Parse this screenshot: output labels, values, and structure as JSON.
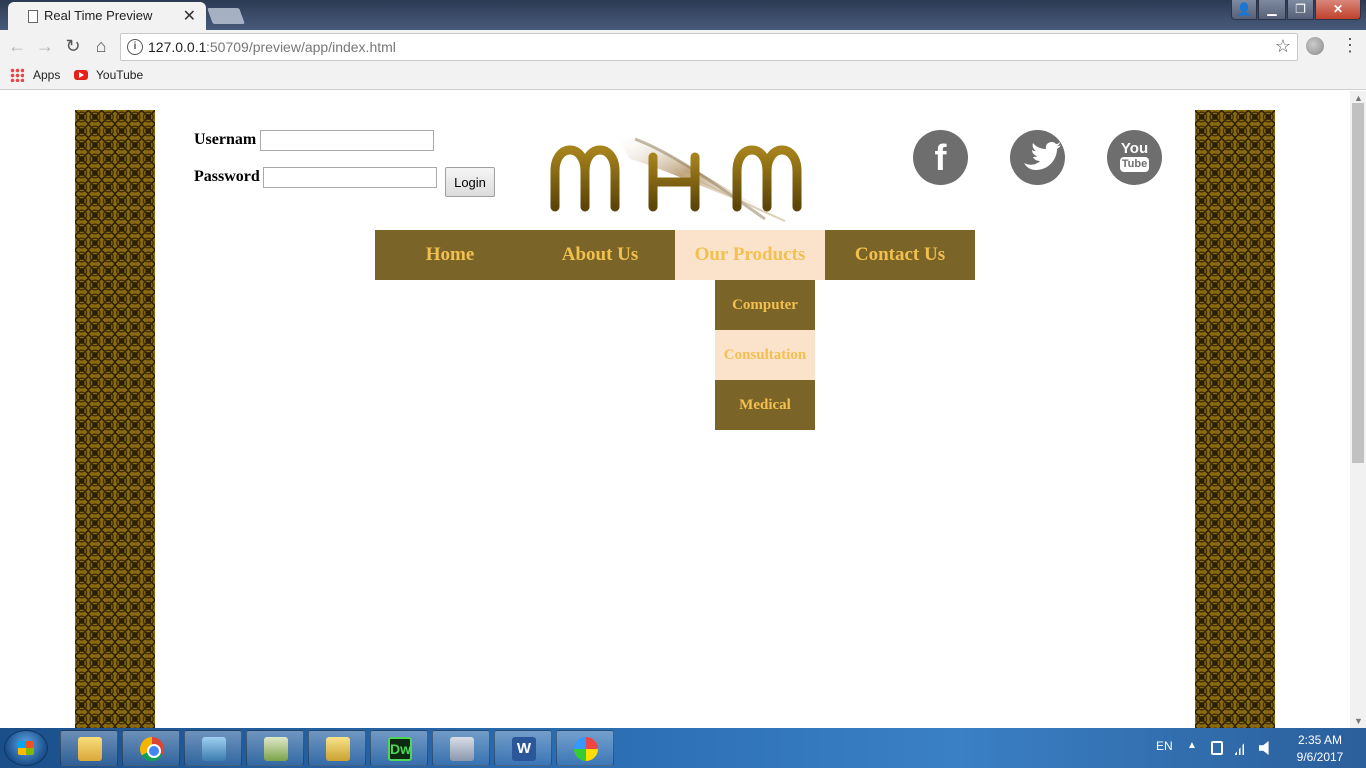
{
  "browser": {
    "tab_title": "Real Time Preview",
    "url_host": "127.0.0.1",
    "url_path": ":50709/preview/app/index.html",
    "bookmarks": [
      {
        "label": "Apps",
        "icon": "apps-grid-icon"
      },
      {
        "label": "YouTube",
        "icon": "youtube-icon"
      }
    ]
  },
  "page": {
    "login": {
      "username_label": "Usernam",
      "password_label": "Password",
      "login_button": "Login"
    },
    "logo_text": "MHM",
    "social": [
      {
        "name": "facebook",
        "glyph": "f"
      },
      {
        "name": "twitter",
        "glyph": "twitter-bird-icon"
      },
      {
        "name": "youtube",
        "you": "You",
        "tube": "Tube"
      }
    ],
    "nav": {
      "items": [
        {
          "label": "Home"
        },
        {
          "label": "About Us"
        },
        {
          "label": "Our Products",
          "active": true
        },
        {
          "label": "Contact Us"
        }
      ],
      "products_dropdown": [
        {
          "label": "Computer"
        },
        {
          "label": "Consultation",
          "hover": true
        },
        {
          "label": "Medical"
        }
      ]
    },
    "colors": {
      "nav_bg": "#7b6428",
      "nav_text": "#f2c04e",
      "nav_active_bg": "#fbe3cb",
      "border_pattern": "#8a6a10"
    }
  },
  "taskbar": {
    "apps": [
      "explorer",
      "chrome",
      "photos",
      "notepad",
      "calendar",
      "dreamweaver",
      "calculator",
      "word",
      "paint"
    ],
    "dreamweaver_glyph": "Dw",
    "word_glyph": "W",
    "language": "EN",
    "time": "2:35 AM",
    "date": "9/6/2017"
  }
}
